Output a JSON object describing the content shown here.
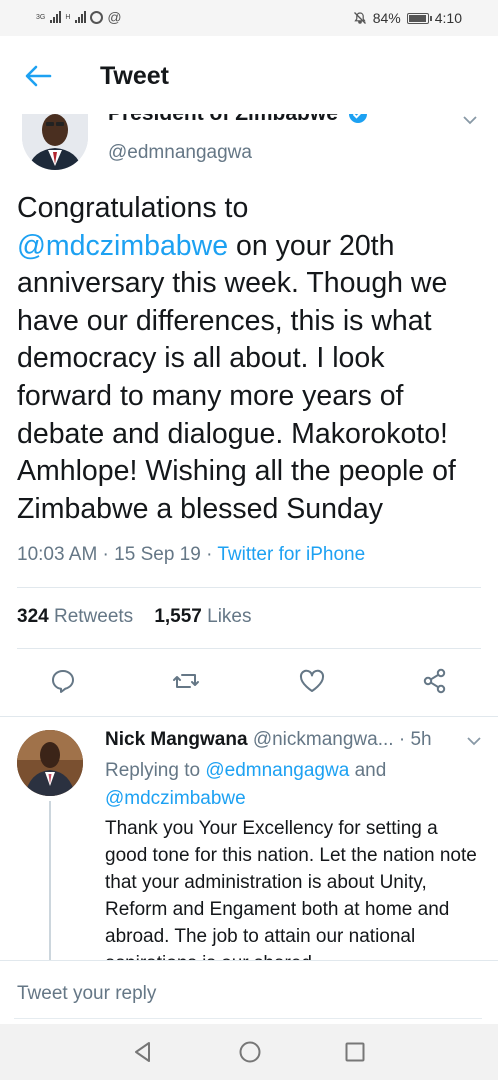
{
  "status_bar": {
    "network_1": "3G",
    "network_2": "H",
    "battery_percent": "84%",
    "battery_level": 0.84,
    "time": "4:10",
    "icons": [
      "signal-icon",
      "sync-icon",
      "at-icon",
      "mute-icon",
      "battery-icon"
    ]
  },
  "app_bar": {
    "title": "Tweet",
    "back_icon": "arrow-left-icon"
  },
  "tweet": {
    "author_name": "President of Zimbabwe",
    "verified": true,
    "author_handle": "@edmnangagwa",
    "text_part1": "Congratulations to",
    "mention": "@mdczimbabwe",
    "text_part2": " on your 20th anniversary this week. Though we have our differences, this is what democracy is all about. I look forward to many more years of debate and dialogue. Makorokoto! Amhlope! Wishing all the people of Zimbabwe a blessed Sunday",
    "timestamp": "10:03 AM · 15 Sep 19 · ",
    "source": "Twitter for iPhone",
    "retweets_count": "324",
    "retweets_label": "Retweets",
    "likes_count": "1,557",
    "likes_label": "Likes",
    "accent_color": "#1da1f2"
  },
  "actions": [
    "reply-icon",
    "retweet-icon",
    "like-icon",
    "share-icon"
  ],
  "reply": {
    "name": "Nick Mangwana",
    "handle": "@nickmangwa...",
    "time": "· 5h",
    "replying_prefix": "Replying to",
    "replying_to_1": "@edmnangagwa",
    "replying_and": "and",
    "replying_to_2": "@mdczimbabwe",
    "text": "Thank you Your Excellency for setting a good tone for this nation.  Let the nation note that your administration is about Unity, Reform and Engament both at home and abroad. The job to attain our national aspirations is our shared"
  },
  "reply_bar": {
    "placeholder": "Tweet your reply"
  },
  "nav_bar": [
    "back-triangle-icon",
    "home-circle-icon",
    "recents-square-icon"
  ]
}
